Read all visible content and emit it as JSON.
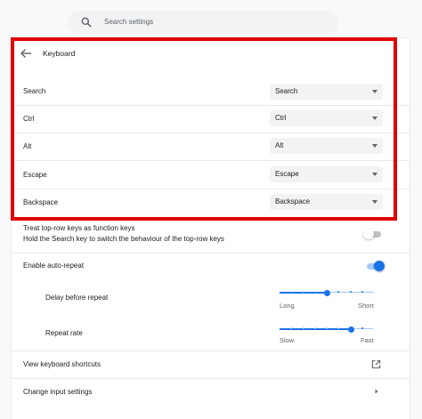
{
  "search": {
    "placeholder": "Search settings"
  },
  "page": {
    "title": "Keyboard"
  },
  "key_mappings": [
    {
      "label": "Search",
      "value": "Search"
    },
    {
      "label": "Ctrl",
      "value": "Ctrl"
    },
    {
      "label": "Alt",
      "value": "Alt"
    },
    {
      "label": "Escape",
      "value": "Escape"
    },
    {
      "label": "Backspace",
      "value": "Backspace"
    }
  ],
  "function_keys": {
    "title": "Treat top-row keys as function keys",
    "subtitle": "Hold the Search key to switch the behaviour of the top-row keys",
    "enabled": false
  },
  "auto_repeat": {
    "label": "Enable auto-repeat",
    "enabled": true
  },
  "delay_before_repeat": {
    "label": "Delay before repeat",
    "min_label": "Long",
    "max_label": "Short",
    "level": 0.5
  },
  "repeat_rate": {
    "label": "Repeat rate",
    "min_label": "Slow",
    "max_label": "Fast",
    "level": 0.75
  },
  "links": {
    "shortcuts": "View keyboard shortcuts",
    "input_settings": "Change input settings"
  },
  "colors": {
    "accent": "#1a73e8",
    "highlight_border": "#e00000",
    "toggle_off_track": "#bdc1c6"
  },
  "icons": {
    "search": "search-icon",
    "back": "back-arrow-icon",
    "external": "open-in-new-icon",
    "chevron": "chevron-right-icon"
  }
}
